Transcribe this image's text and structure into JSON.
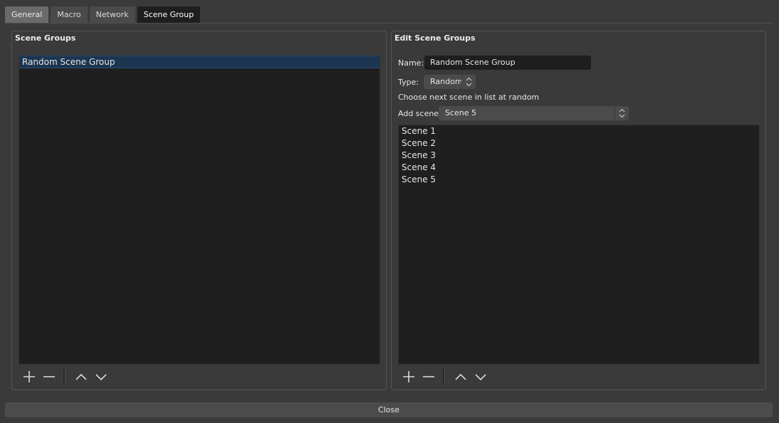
{
  "tabs": [
    {
      "label": "General"
    },
    {
      "label": "Macro"
    },
    {
      "label": "Network"
    },
    {
      "label": "Scene Group"
    }
  ],
  "left_panel": {
    "title": "Scene Groups",
    "items": [
      "Random Scene Group"
    ],
    "selected_index": 0,
    "toolbar": [
      "plus-icon",
      "minus-icon",
      "arrow-up-icon",
      "arrow-down-icon"
    ]
  },
  "right_panel": {
    "title": "Edit Scene Groups",
    "name_label": "Name:",
    "name_value": "Random Scene Group",
    "type_label": "Type:",
    "type_value": "Random",
    "type_description": "Choose next scene in list at random",
    "add_scene_label": "Add scene",
    "add_scene_value": "Scene 5",
    "scenes": [
      "Scene 1",
      "Scene 2",
      "Scene 3",
      "Scene 4",
      "Scene 5"
    ],
    "toolbar": [
      "plus-icon",
      "minus-icon",
      "arrow-up-icon",
      "arrow-down-icon"
    ]
  },
  "footer": {
    "close_label": "Close"
  },
  "colors": {
    "selection": "#1c3550",
    "active_tab": "#1e1e1e",
    "background": "#3a3a3a"
  }
}
